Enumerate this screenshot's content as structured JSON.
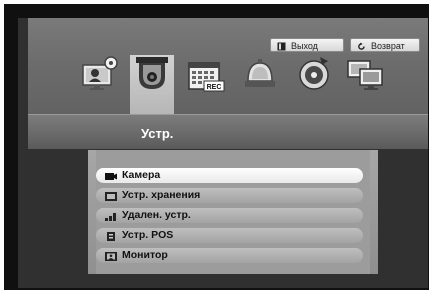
{
  "toolbar": {
    "exit_label": "Выход",
    "back_label": "Возврат"
  },
  "category_icons": [
    {
      "name": "system-settings-icon"
    },
    {
      "name": "camera-dome-icon",
      "selected": true
    },
    {
      "name": "record-schedule-icon",
      "badge": "REC"
    },
    {
      "name": "event-alarm-icon"
    },
    {
      "name": "backup-disc-icon"
    },
    {
      "name": "network-icon"
    }
  ],
  "section_title": "Устр.",
  "menu": {
    "items": [
      {
        "label": "Камера",
        "icon": "camera-icon",
        "active": true
      },
      {
        "label": "Устр. хранения",
        "icon": "storage-icon",
        "active": false
      },
      {
        "label": "Удален. устр.",
        "icon": "remote-device-icon",
        "active": false
      },
      {
        "label": "Устр. POS",
        "icon": "pos-icon",
        "active": false
      },
      {
        "label": "Монитор",
        "icon": "monitor-icon",
        "active": false
      }
    ]
  }
}
